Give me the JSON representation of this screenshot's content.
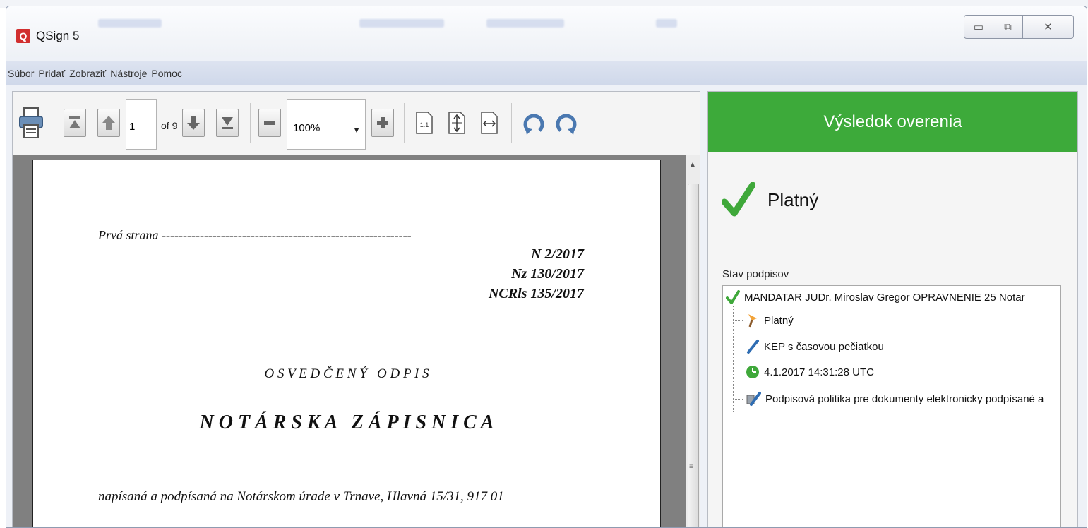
{
  "window": {
    "title": "QSign 5",
    "logo": "Q"
  },
  "window_controls": {
    "minimize": "▭",
    "maximize": "⧉",
    "close": "✕"
  },
  "menu": [
    "Súbor",
    "Pridať",
    "Zobraziť",
    "Nástroje",
    "Pomoc"
  ],
  "toolbar": {
    "page_value": "1",
    "page_of": "of 9",
    "zoom_value": "100%",
    "zoom_fit_actual": "1:1"
  },
  "document": {
    "line_first": "Prvá strana -----------------------------------------------------------",
    "ref1": "N 2/2017",
    "ref2": "Nz 130/2017",
    "ref3": "NCRls 135/2017",
    "heading_small": "O S V E D Č E N Ý   O D P I S",
    "heading_big": "N O T Á R S K A   Z Á P I S N I C A",
    "body_line": "napísaná a podpísaná na Notárskom úrade v Trnave, Hlavná 15/31, 917 01"
  },
  "result": {
    "header": "Výsledok overenia",
    "status": "Platný",
    "signatures_label": "Stav podpisov",
    "tree": {
      "root": "MANDATAR JUDr. Miroslav Gregor OPRAVNENIE 25 Notar",
      "children": [
        "Platný",
        "KEP s časovou pečiatkou",
        "4.1.2017 14:31:28 UTC",
        "Podpisová politika pre dokumenty elektronicky podpísané a"
      ]
    }
  },
  "colors": {
    "accent_green": "#3daa3a",
    "check_green": "#3fa83a",
    "logo_red": "#d12f2f"
  }
}
